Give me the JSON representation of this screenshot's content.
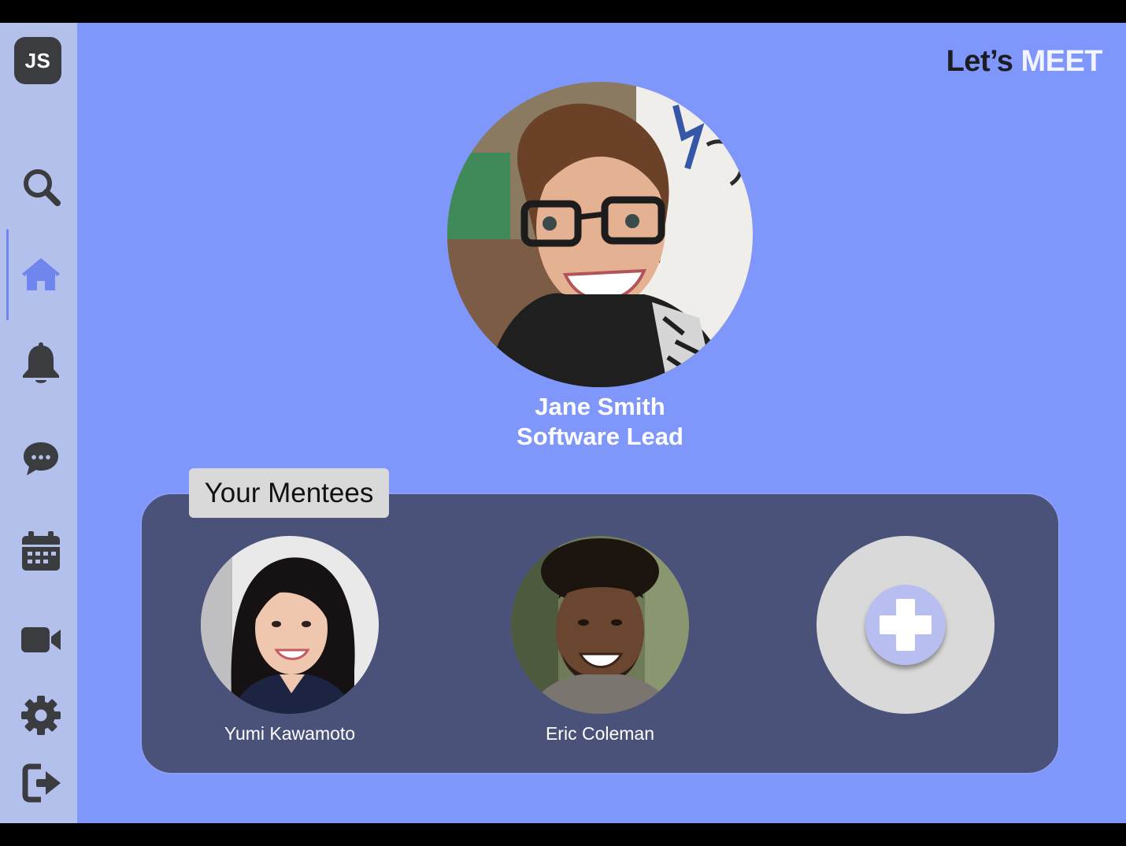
{
  "user": {
    "initials": "JS"
  },
  "brand": {
    "part1": "Let’s ",
    "part2": "MEET"
  },
  "profile": {
    "name": "Jane Smith",
    "role": "Software Lead"
  },
  "mentees_section": {
    "title": "Your Mentees",
    "mentees": [
      {
        "name": "Yumi Kawamoto"
      },
      {
        "name": "Eric Coleman"
      }
    ]
  },
  "sidebar": {
    "active_item": "home-icon",
    "items": [
      "search-icon",
      "home-icon",
      "bell-icon",
      "chat-icon",
      "calendar-icon",
      "video-icon",
      "gear-icon",
      "logout-icon"
    ]
  },
  "colors": {
    "background": "#7f97fb",
    "sidebar": "#b3c0ec",
    "panel": "#4a527a",
    "active_icon": "#6f86ef",
    "icon": "#3b3c40"
  }
}
